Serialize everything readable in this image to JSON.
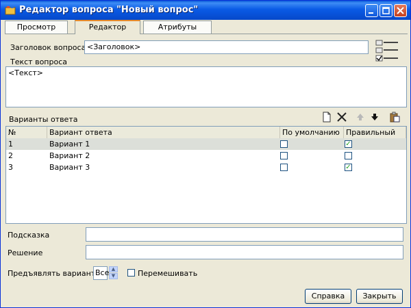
{
  "window": {
    "title": "Редактор вопроса \"Новый вопрос\""
  },
  "tabs": [
    {
      "label": "Просмотр",
      "active": false
    },
    {
      "label": "Редактор",
      "active": true
    },
    {
      "label": "Атрибуты",
      "active": false
    }
  ],
  "question": {
    "title_label": "Заголовок вопроса",
    "title_value": "<Заголовок>",
    "text_label": "Текст вопроса",
    "text_value": "<Текст>"
  },
  "answers": {
    "label": "Варианты ответа",
    "toolbar_icons": [
      "new-document-icon",
      "delete-x-icon",
      "move-up-arrow-icon",
      "move-down-arrow-icon",
      "paste-clipboard-icon"
    ],
    "columns": [
      "№",
      "Вариант ответа",
      "По умолчанию",
      "Правильный"
    ],
    "rows": [
      {
        "num": "1",
        "text": "Вариант 1",
        "default": false,
        "correct": true
      },
      {
        "num": "2",
        "text": "Вариант 2",
        "default": false,
        "correct": false
      },
      {
        "num": "3",
        "text": "Вариант 3",
        "default": false,
        "correct": true
      }
    ]
  },
  "hint": {
    "label": "Подсказка",
    "value": ""
  },
  "solution": {
    "label": "Решение",
    "value": ""
  },
  "options": {
    "show_variants_label": "Предъявлять вариантов",
    "show_variants_value": "Все",
    "shuffle_label": "Перемешивать",
    "shuffle_checked": false
  },
  "buttons": {
    "help": "Справка",
    "close": "Закрыть"
  },
  "colors": {
    "title_bar": "#0a5be6",
    "check": "#21a121",
    "tab_highlight": "#e68b2c"
  }
}
